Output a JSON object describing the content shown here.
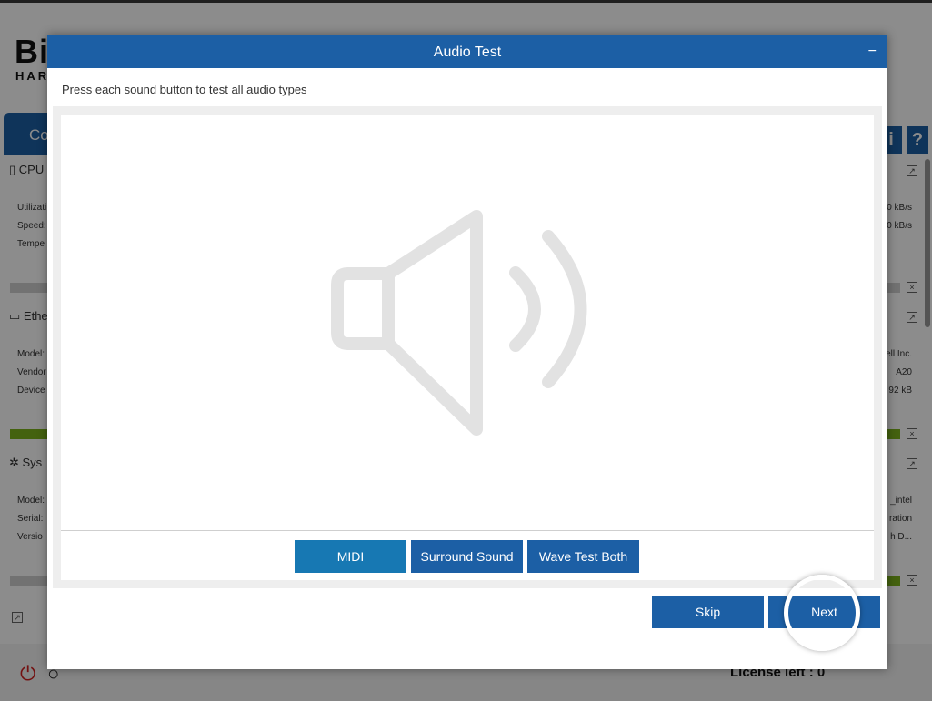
{
  "app": {
    "logo_text": "Bi",
    "logo_sub": "HARD",
    "tab_label": "Co",
    "info_icon": "i",
    "help_icon": "?",
    "panels": [
      {
        "title": "CPU",
        "rows": [
          "Utilizati",
          "Speed:",
          "Tempe"
        ],
        "right": [
          "0 kB/s",
          "0 kB/s"
        ]
      },
      {
        "title": "Ethe",
        "rows": [
          "Model:",
          "Vendor",
          "Device"
        ],
        "right": [
          "ell Inc.",
          "A20",
          "92 kB"
        ]
      },
      {
        "title": "Sys",
        "rows": [
          "Model:",
          "Serial:",
          "Versio"
        ],
        "right": [
          "_intel",
          "ration",
          "h D..."
        ]
      }
    ],
    "license": "License left : 0"
  },
  "modal": {
    "title": "Audio Test",
    "minimize": "−",
    "instructions": "Press each sound button to test all audio types",
    "buttons": {
      "midi": "MIDI",
      "surround": "Surround Sound",
      "wave": "Wave Test Both"
    },
    "skip": "Skip",
    "next": "Next"
  },
  "icons": {
    "speaker": "speaker-icon",
    "power": "power-icon",
    "refresh": "refresh-icon"
  },
  "colors": {
    "accent": "#1c5fa5",
    "midi_button": "#1778b3",
    "bar_green": "#7db21d",
    "power_red": "#d21f1f"
  }
}
